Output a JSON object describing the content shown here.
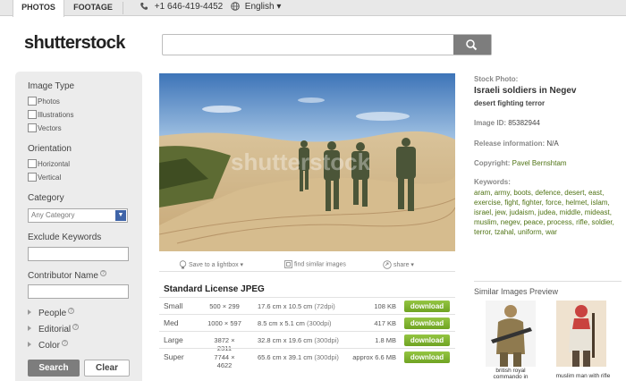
{
  "nav": {
    "tabs": [
      {
        "label": "PHOTOS",
        "active": true
      },
      {
        "label": "FOOTAGE",
        "active": false
      }
    ],
    "phone": "+1 646-419-4452",
    "language": "English ▾"
  },
  "logo": "shutterstock",
  "search": {
    "value": "",
    "placeholder": ""
  },
  "sidebar": {
    "image_type_heading": "Image Type",
    "image_types": [
      "Photos",
      "Illustrations",
      "Vectors"
    ],
    "orientation_heading": "Orientation",
    "orientations": [
      "Horizontal",
      "Vertical"
    ],
    "category_heading": "Category",
    "category_selected": "Any Category",
    "exclude_heading": "Exclude Keywords",
    "contributor_heading": "Contributor Name",
    "expanders": [
      "People",
      "Editorial",
      "Color"
    ],
    "search_button": "Search",
    "clear_button": "Clear"
  },
  "photo": {
    "watermark": "shutterstock"
  },
  "photo_tools": {
    "lightbox": "Save to a lightbox ▾",
    "similar": "find similar images",
    "share": "share ▾"
  },
  "license": {
    "title": "Standard License JPEG",
    "rows": [
      {
        "size": "Small",
        "px_w": "500",
        "px_h": "299",
        "cm": "17.6 cm x 10.5 cm",
        "dpi": "(72dpi)",
        "file": "108 KB",
        "button": "download"
      },
      {
        "size": "Med",
        "px_w": "1000",
        "px_h": "597",
        "cm": "8.5 cm x 5.1 cm",
        "dpi": "(300dpi)",
        "file": "417 KB",
        "button": "download"
      },
      {
        "size": "Large",
        "px_w": "3872",
        "px_h": "2311",
        "cm": "32.8 cm x 19.6 cm",
        "dpi": "(300dpi)",
        "file": "1.8 MB",
        "button": "download"
      },
      {
        "size": "Super",
        "px_w": "7744",
        "px_h": "4622",
        "cm": "65.6 cm x 39.1 cm",
        "dpi": "(300dpi)",
        "file": "approx 6.6 MB",
        "button": "download"
      }
    ]
  },
  "info": {
    "stock_label": "Stock Photo:",
    "title": "Israeli soldiers in Negev",
    "subtitle": "desert fighting terror",
    "image_id_label": "Image ID:",
    "image_id": "85382944",
    "release_label": "Release information:",
    "release": "N/A",
    "copyright_label": "Copyright:",
    "copyright": "Pavel Bernshtam",
    "keywords_label": "Keywords:",
    "keywords": [
      "aram",
      "army",
      "boots",
      "defence",
      "desert",
      "east",
      "exercise",
      "fight",
      "fighter",
      "force",
      "helmet",
      "islam",
      "israel",
      "jew",
      "judaism",
      "judea",
      "middle",
      "mideast",
      "muslim",
      "negev",
      "peace",
      "process",
      "rifle",
      "soldier",
      "terror",
      "tzahal",
      "uniform",
      "war"
    ]
  },
  "similar": {
    "heading": "Similar Images Preview",
    "items": [
      {
        "caption_1": "british royal",
        "caption_2": "commando in"
      },
      {
        "caption_1": "muslim man with rifle",
        "caption_2": ""
      }
    ]
  }
}
